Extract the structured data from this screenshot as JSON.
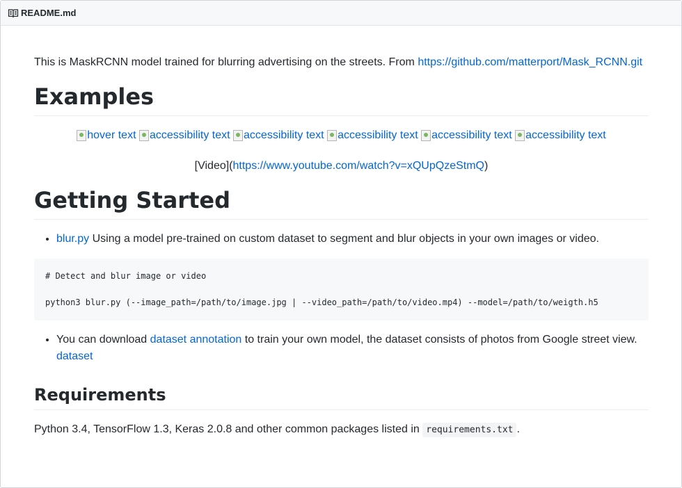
{
  "file_header": {
    "icon": "book-icon",
    "filename": "README.md"
  },
  "intro": {
    "text": "This is MaskRCNN model trained for blurring advertising on the streets. From ",
    "link": "https://github.com/matterport/Mask_RCNN.git"
  },
  "examples": {
    "heading": "Examples",
    "images": [
      {
        "alt": "hover text"
      },
      {
        "alt": "accessibility text"
      },
      {
        "alt": "accessibility text"
      },
      {
        "alt": "accessibility text"
      },
      {
        "alt": "accessibility text"
      },
      {
        "alt": "accessibility text"
      }
    ],
    "video_prefix": "[Video](",
    "video_link": "https://www.youtube.com/watch?v=xQUpQzeStmQ",
    "video_suffix": ")"
  },
  "getting_started": {
    "heading": "Getting Started",
    "bullet1_link": "blur.py",
    "bullet1_text": " Using a model pre-trained on custom dataset to segment and blur objects in your own images or video.",
    "code_line1": "# Detect and blur image or video",
    "code_line2": "python3 blur.py (--image_path=/path/to/image.jpg | --video_path=/path/to/video.mp4) --model=/path/to/weigth.h5",
    "bullet2_prefix": "You can download ",
    "bullet2_link": "dataset annotation",
    "bullet2_text": " to train your own model, the dataset consists of photos from Google street view.",
    "bullet2_link2": "dataset"
  },
  "requirements": {
    "heading": "Requirements",
    "text": "Python 3.4, TensorFlow 1.3, Keras 2.0.8 and other common packages listed in ",
    "code": "requirements.txt",
    "suffix": "."
  }
}
